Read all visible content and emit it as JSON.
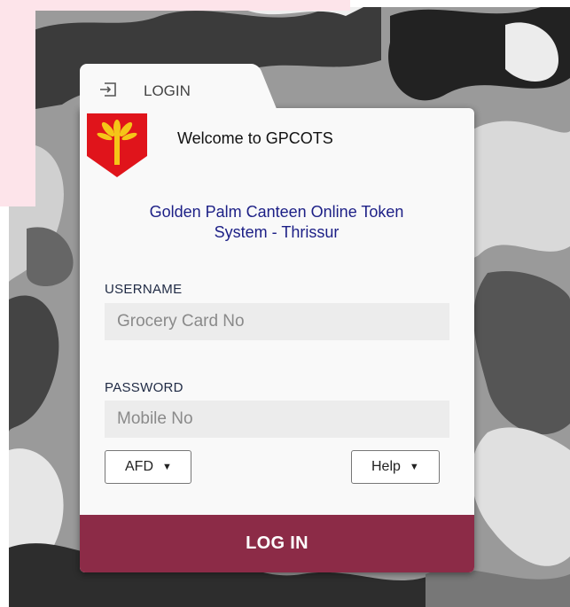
{
  "colors": {
    "accent": "#8c2b47",
    "title_blue": "#1c1f86",
    "crest_red": "#e0141b",
    "crest_gold": "#f5c518"
  },
  "tab": {
    "label": "LOGIN",
    "icon": "login-arrow-icon"
  },
  "header": {
    "welcome": "Welcome to GPCOTS",
    "logo": "golden-palm-crest-icon"
  },
  "system_name_line1": "Golden Palm Canteen Online Token",
  "system_name_line2": "System - Thrissur",
  "form": {
    "username_label": "USERNAME",
    "username_placeholder": "Grocery Card No",
    "password_label": "PASSWORD",
    "password_placeholder": "Mobile No"
  },
  "dropdowns": {
    "service_label": "AFD",
    "help_label": "Help"
  },
  "login_button": "LOG IN"
}
